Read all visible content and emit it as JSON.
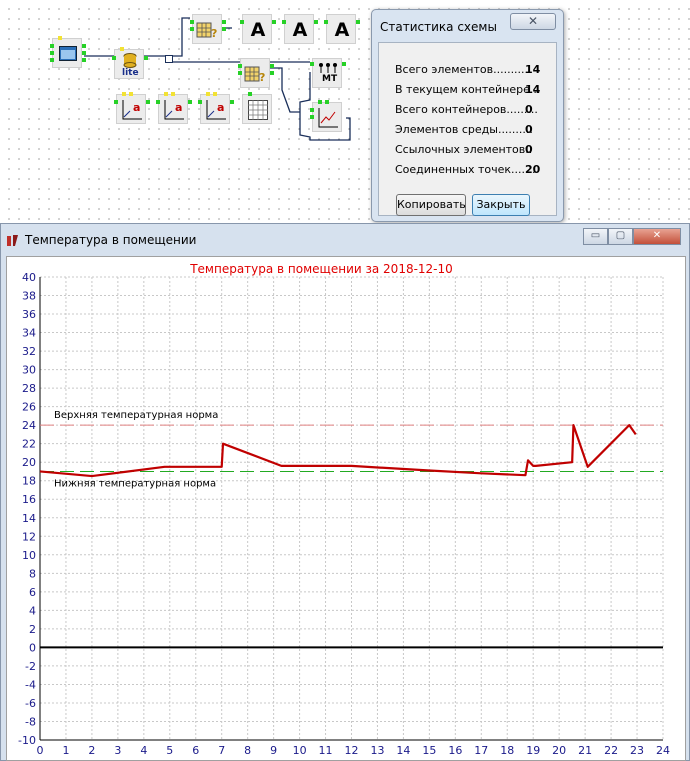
{
  "stats_dialog": {
    "title": "Статистика схемы",
    "rows": [
      {
        "label": "Всего элементов...........",
        "value": "14"
      },
      {
        "label": "В текущем контейнере...",
        "value": "14"
      },
      {
        "label": "Всего контейнеров.........",
        "value": "0"
      },
      {
        "label": "Элементов среды..........",
        "value": "0"
      },
      {
        "label": "Ссылочных элементов..",
        "value": "0"
      },
      {
        "label": "Соединенных точек.......",
        "value": "20"
      }
    ],
    "copy_button": "Копировать",
    "close_button": "Закрыть"
  },
  "scheme": {
    "sqlite_label": "lite",
    "mt_label": "MT",
    "text_block_glyph": "A",
    "plot_glyph": "a"
  },
  "chart_window": {
    "title": "Температура в помещении",
    "controls": {
      "minimize": "▭",
      "maximize": "▢",
      "close": "✕"
    }
  },
  "chart_data": {
    "type": "line",
    "title": "Температура в помещении за 2018-12-10",
    "xlim": [
      0,
      24
    ],
    "ylim": [
      -10,
      40
    ],
    "x_ticks": [
      0,
      1,
      2,
      3,
      4,
      5,
      6,
      7,
      8,
      9,
      10,
      11,
      12,
      13,
      14,
      15,
      16,
      17,
      18,
      19,
      20,
      21,
      22,
      23,
      24
    ],
    "y_ticks": [
      -10,
      -8,
      -6,
      -4,
      -2,
      0,
      2,
      4,
      6,
      8,
      10,
      12,
      14,
      16,
      18,
      20,
      22,
      24,
      26,
      28,
      30,
      32,
      34,
      36,
      38,
      40
    ],
    "grid": true,
    "reference_lines": [
      {
        "label": "Верхняя температурная норма",
        "y": 24,
        "color": "#e08080"
      },
      {
        "label": "Нижняя температурная норма",
        "y": 19,
        "color": "#22aa22"
      }
    ],
    "zero_line": 0,
    "series": [
      {
        "color": "#c00000",
        "x": [
          0,
          2,
          4.8,
          7.0,
          7.05,
          9.3,
          12,
          15,
          17,
          18.7,
          18.8,
          19.0,
          19.1,
          20.5,
          20.55,
          21.1,
          22.7,
          22.95
        ],
        "y": [
          19,
          18.5,
          19.5,
          19.5,
          22,
          19.6,
          19.6,
          19.1,
          18.8,
          18.6,
          20.2,
          19.6,
          19.6,
          20,
          24,
          19.5,
          24,
          23
        ]
      }
    ]
  }
}
